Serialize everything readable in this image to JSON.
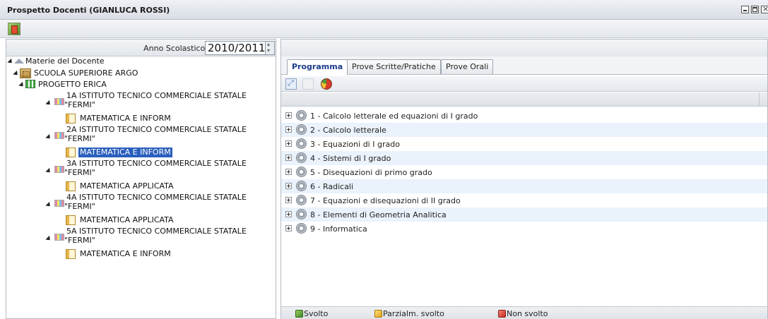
{
  "window": {
    "title": "Prospetto Docenti (GIANLUCA ROSSI)"
  },
  "toolbar": {
    "exit_icon": "exit-door-icon"
  },
  "left": {
    "anno_label": "Anno Scolastico:",
    "anno_value": "2010/2011",
    "tree": {
      "root": "Materie del Docente",
      "school": "SCUOLA SUPERIORE ARGO",
      "project": "PROGETTO ERICA",
      "classes": [
        {
          "line1": "1A ISTITUTO TECNICO COMMERCIALE STATALE",
          "line2": "\"FERMI\"",
          "subject": "MATEMATICA E INFORM",
          "selected": false
        },
        {
          "line1": "2A ISTITUTO TECNICO COMMERCIALE STATALE",
          "line2": "\"FERMI\"",
          "subject": "MATEMATICA E INFORM",
          "selected": true
        },
        {
          "line1": "3A ISTITUTO TECNICO COMMERCIALE STATALE",
          "line2": "\"FERMI\"",
          "subject": "MATEMATICA APPLICATA",
          "selected": false
        },
        {
          "line1": "4A ISTITUTO TECNICO COMMERCIALE STATALE",
          "line2": "\"FERMI\"",
          "subject": "MATEMATICA APPLICATA",
          "selected": false
        },
        {
          "line1": "5A ISTITUTO TECNICO COMMERCIALE STATALE",
          "line2": "\"FERMI\"",
          "subject": "MATEMATICA E INFORM",
          "selected": false
        }
      ]
    }
  },
  "right": {
    "tabs": [
      "Programma",
      "Prove Scritte/Pratiche",
      "Prove Orali"
    ],
    "active_tab": "Programma",
    "items": [
      "1 - Calcolo letterale ed equazioni di I grado",
      "2 - Calcolo letterale",
      "3 - Equazioni di I grado",
      "4 - Sistemi di I grado",
      "5 - Disequazioni di primo grado",
      "6 - Radicali",
      "7 - Equazioni e disequazioni di II grado",
      "8 - Elementi di Geometria Analitica",
      "9 - Informatica"
    ],
    "legend": {
      "done": "Svolto",
      "partial": "Parzialm. svolto",
      "not_done": "Non svolto"
    }
  },
  "colors": {
    "selection": "#2a5fbd",
    "active_tab_text": "#1a3c8a",
    "row_alt": "#eaf2fb"
  }
}
